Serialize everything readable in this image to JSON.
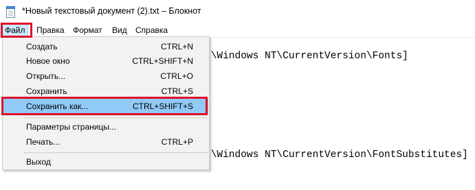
{
  "window": {
    "title": "*Новый текстовый документ (2).txt – Блокнот",
    "icon": "notepad-icon"
  },
  "menubar": {
    "items": [
      {
        "label": "Файл"
      },
      {
        "label": "Правка"
      },
      {
        "label": "Формат"
      },
      {
        "label": "Вид"
      },
      {
        "label": "Справка"
      }
    ]
  },
  "editor": {
    "lines": [
      "t\\Windows NT\\CurrentVersion\\Fonts]",
      "t\\Windows NT\\CurrentVersion\\FontSubstitutes]"
    ]
  },
  "file_menu": {
    "items": [
      {
        "label": "Создать",
        "shortcut": "CTRL+N"
      },
      {
        "label": "Новое окно",
        "shortcut": "CTRL+SHIFT+N"
      },
      {
        "label": "Открыть...",
        "shortcut": "CTRL+O"
      },
      {
        "label": "Сохранить",
        "shortcut": "CTRL+S"
      },
      {
        "label": "Сохранить как...",
        "shortcut": "CTRL+SHIFT+S"
      },
      {
        "label": "Параметры страницы...",
        "shortcut": ""
      },
      {
        "label": "Печать...",
        "shortcut": "CTRL+P"
      },
      {
        "label": "Выход",
        "shortcut": ""
      }
    ]
  },
  "colors": {
    "highlight_outline": "#e0102a",
    "menu_hover": "#91c9f7",
    "menu_background": "#f2f2f2"
  }
}
